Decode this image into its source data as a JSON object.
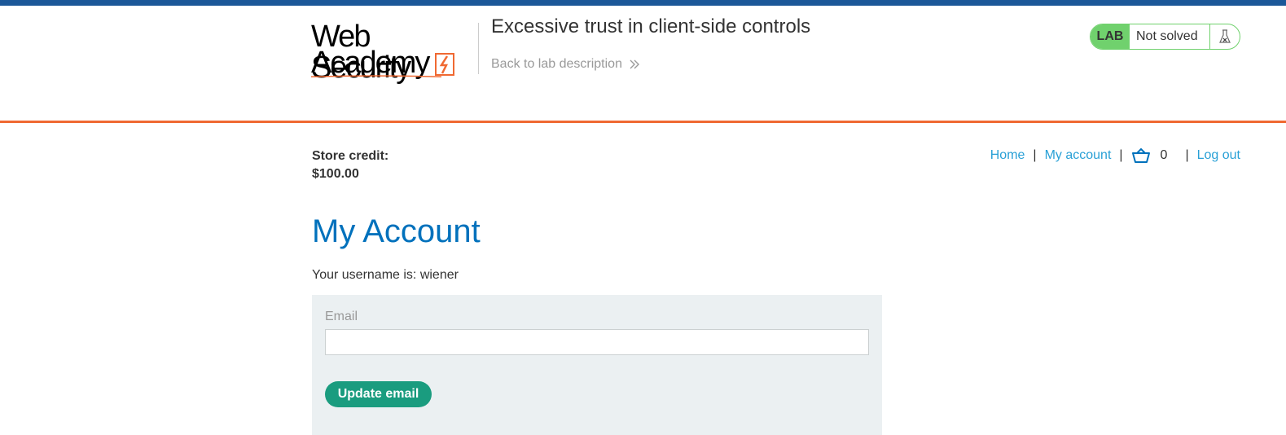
{
  "header": {
    "logo": {
      "line1": "Web Security",
      "line2": "Academy"
    },
    "lab_title": "Excessive trust in client-side controls",
    "back_link": "Back to lab description",
    "status": {
      "badge": "LAB",
      "text": "Not solved",
      "icon": "flask-icon"
    }
  },
  "store": {
    "credit_label": "Store credit:",
    "credit_value": "$100.00"
  },
  "nav": {
    "home": "Home",
    "my_account": "My account",
    "cart_count": "0",
    "log_out": "Log out",
    "separator": "|"
  },
  "main": {
    "title": "My Account",
    "username_text": "Your username is: wiener",
    "form": {
      "email_label": "Email",
      "email_value": "",
      "update_button": "Update email"
    }
  },
  "colors": {
    "top_bar": "#1b5798",
    "accent_orange": "#f06932",
    "link_blue": "#29a0d6",
    "title_blue": "#0071bc",
    "lab_green": "#70d16d",
    "button_green": "#1a9c7f",
    "form_bg": "#ebf0f2"
  }
}
